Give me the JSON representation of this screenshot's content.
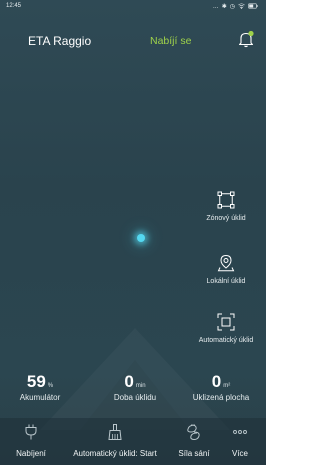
{
  "status_bar": {
    "time": "12:45",
    "icons": [
      "dots-icon",
      "bluetooth-icon",
      "alarm-icon",
      "wifi-icon",
      "battery-icon"
    ]
  },
  "header": {
    "device_name": "ETA Raggio",
    "status": "Nabíjí se",
    "status_color": "#9fd24a"
  },
  "actions": {
    "zone_label": "Zónový úklid",
    "local_label": "Lokální úklid",
    "auto_label": "Automatický úklid"
  },
  "stats": {
    "battery_value": "59",
    "battery_unit": "%",
    "battery_label": "Akumulátor",
    "time_value": "0",
    "time_unit": "min",
    "time_label": "Doba úklidu",
    "area_value": "0",
    "area_unit": "m²",
    "area_label": "Uklizená plocha"
  },
  "bottom_bar": {
    "charge_label": "Nabíjení",
    "auto_label": "Automatický úklid: Start",
    "suction_label": "Síla sání",
    "more_label": "Více"
  },
  "colors": {
    "background": "#2c4550",
    "accent_dot": "#54d8f0"
  }
}
